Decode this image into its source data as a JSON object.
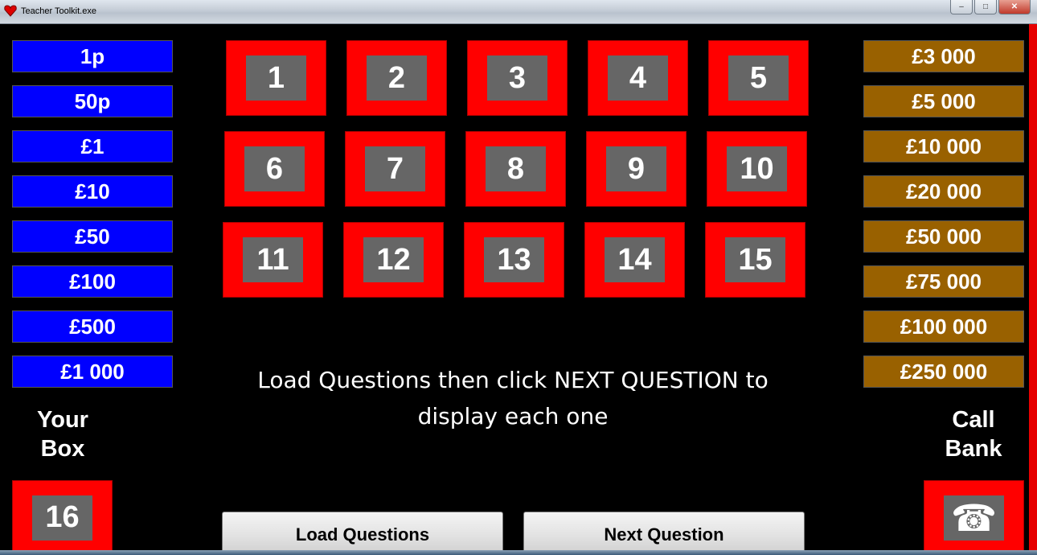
{
  "window": {
    "title": "Teacher Toolkit.exe",
    "controls": {
      "minimize": "–",
      "maximize": "□",
      "close": "✕"
    }
  },
  "left_amounts": [
    "1p",
    "50p",
    "£1",
    "£10",
    "£50",
    "£100",
    "£500",
    "£1 000"
  ],
  "right_amounts": [
    "£3 000",
    "£5 000",
    "£10 000",
    "£20 000",
    "£50 000",
    "£75 000",
    "£100 000",
    "£250 000"
  ],
  "boxes": [
    "1",
    "2",
    "3",
    "4",
    "5",
    "6",
    "7",
    "8",
    "9",
    "10",
    "11",
    "12",
    "13",
    "14",
    "15"
  ],
  "message": {
    "line1": "Load Questions then click NEXT QUESTION to",
    "line2": "display each one"
  },
  "your_box": {
    "label_line1": "Your",
    "label_line2": "Box",
    "number": "16"
  },
  "call_bank": {
    "label_line1": "Call",
    "label_line2": "Bank",
    "icon": "telephone-icon",
    "glyph": "☎"
  },
  "buttons": {
    "load": "Load Questions",
    "next": "Next Question"
  },
  "colors": {
    "box_red": "#ff0000",
    "box_inner": "#666666",
    "left_blue": "#0000ff",
    "right_brown": "#996100"
  }
}
